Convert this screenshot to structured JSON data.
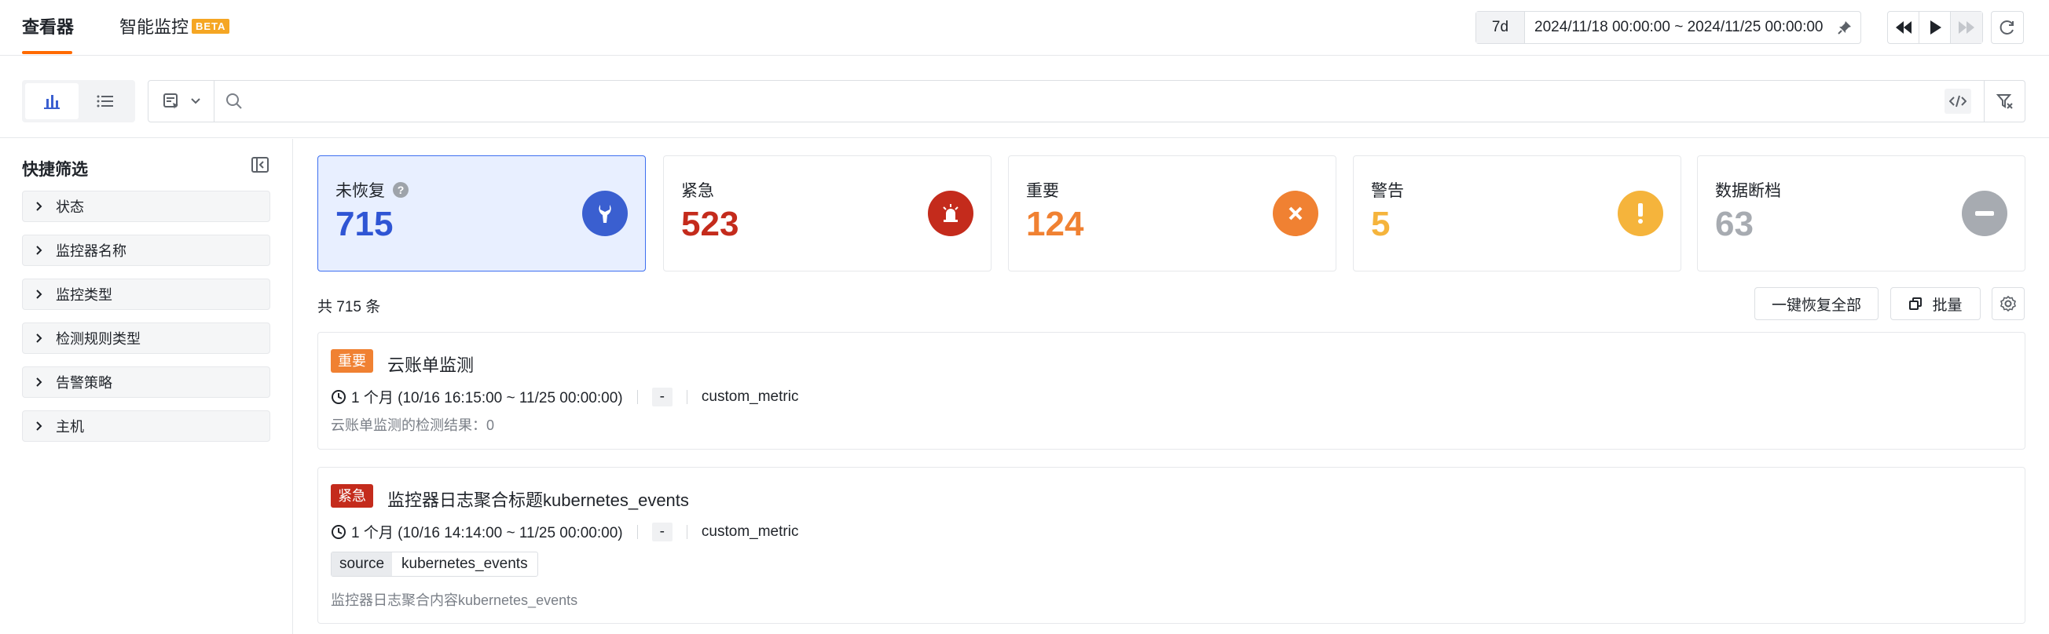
{
  "nav": {
    "tabs": [
      {
        "label": "查看器",
        "active": true
      },
      {
        "label": "智能监控",
        "active": false
      }
    ],
    "beta_badge": "BETA"
  },
  "time": {
    "range_label": "7d",
    "range_text": "2024/11/18 00:00:00 ~ 2024/11/25 00:00:00"
  },
  "search": {
    "placeholder": ""
  },
  "sidebar": {
    "title": "快捷筛选",
    "items": [
      {
        "label": "状态"
      },
      {
        "label": "监控器名称"
      },
      {
        "label": "监控类型"
      },
      {
        "label": "检测规则类型"
      },
      {
        "label": "告警策略"
      },
      {
        "label": "主机"
      }
    ]
  },
  "stats": [
    {
      "label": "未恢复",
      "value": "715",
      "color": "#2f55d4",
      "icon_color": "#3a5fd0",
      "icon": "wrench-icon",
      "selected": true
    },
    {
      "label": "紧急",
      "value": "523",
      "color": "#c42b1c",
      "icon_color": "#c42b1c",
      "icon": "siren-icon",
      "selected": false
    },
    {
      "label": "重要",
      "value": "124",
      "color": "#f08132",
      "icon_color": "#f08132",
      "icon": "x-circle-icon",
      "selected": false
    },
    {
      "label": "警告",
      "value": "5",
      "color": "#f5b43c",
      "icon_color": "#f5b43c",
      "icon": "exclamation-icon",
      "selected": false
    },
    {
      "label": "数据断档",
      "value": "63",
      "color": "#a7abb1",
      "icon_color": "#a7abb1",
      "icon": "minus-icon",
      "selected": false
    }
  ],
  "list": {
    "count_text": "共 715 条",
    "recover_all_label": "一键恢复全部",
    "batch_label": "批量"
  },
  "events": [
    {
      "level": "重要",
      "level_color": "#f08132",
      "title": "云账单监测",
      "duration": "1 个月 (10/16 16:15:00 ~ 11/25 00:00:00)",
      "dash": "-",
      "metric_type": "custom_metric",
      "tag_key": "",
      "tag_value": "",
      "description": "云账单监测的检测结果：0"
    },
    {
      "level": "紧急",
      "level_color": "#c42b1c",
      "title": "监控器日志聚合标题kubernetes_events",
      "duration": "1 个月 (10/16 14:14:00 ~ 11/25 00:00:00)",
      "dash": "-",
      "metric_type": "custom_metric",
      "tag_key": "source",
      "tag_value": "kubernetes_events",
      "description": "监控器日志聚合内容kubernetes_events"
    }
  ]
}
